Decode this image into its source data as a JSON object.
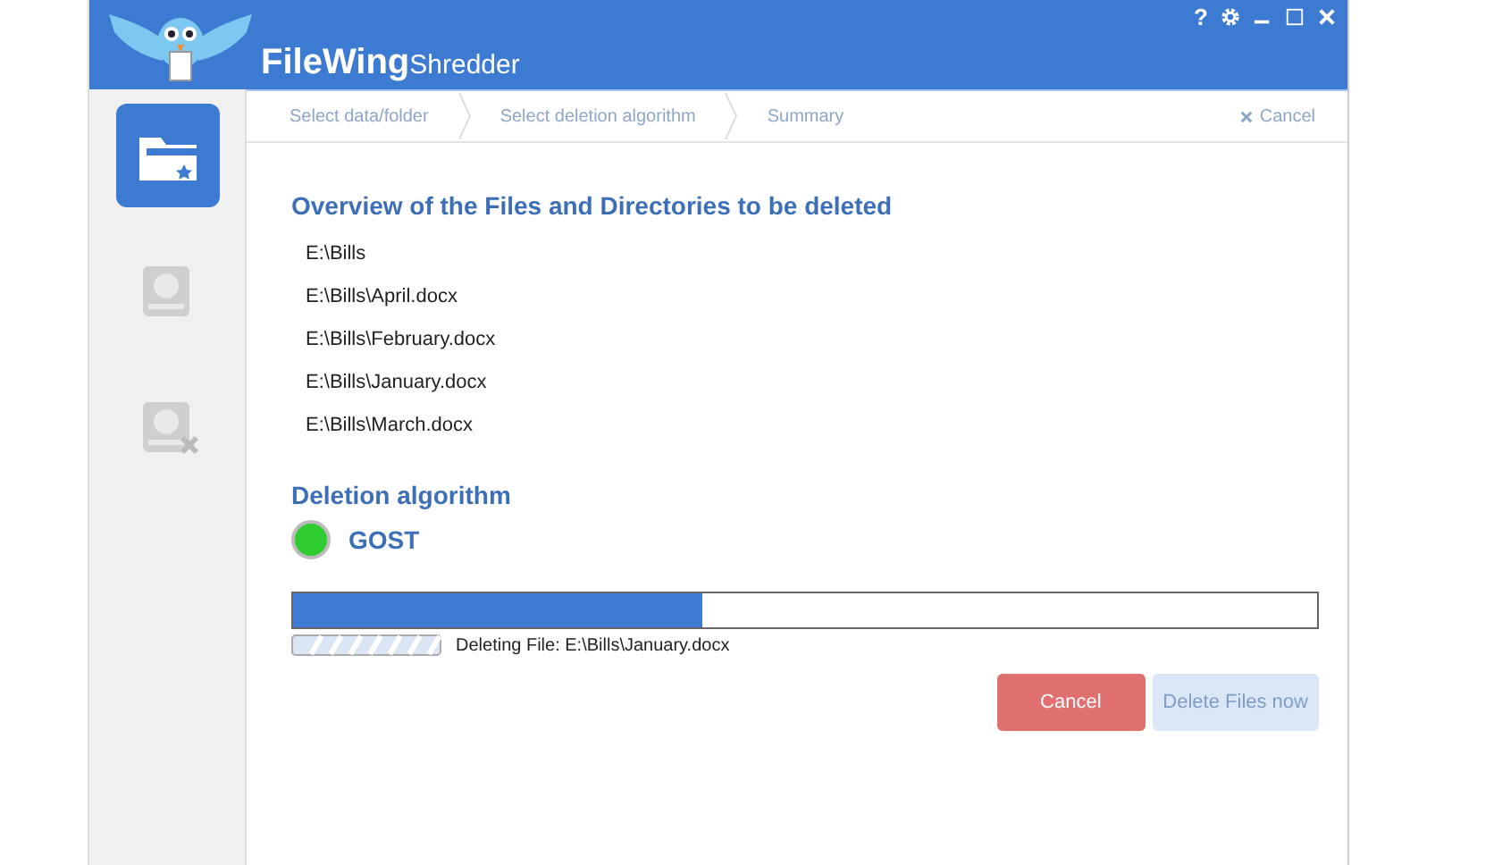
{
  "window": {
    "title_main": "FileWing",
    "title_sub": "Shredder",
    "help": "?"
  },
  "sidebar": {
    "items": [
      {
        "selected": true
      },
      {
        "selected": false
      },
      {
        "selected": false
      }
    ]
  },
  "steps": [
    "Select data/folder",
    "Select deletion algorithm",
    "Summary"
  ],
  "step_cancel": "Cancel",
  "overview": {
    "heading": "Overview of the Files and Directories to be deleted",
    "files": [
      "E:\\Bills",
      "E:\\Bills\\April.docx",
      "E:\\Bills\\February.docx",
      "E:\\Bills\\January.docx",
      "E:\\Bills\\March.docx"
    ]
  },
  "algorithm": {
    "heading": "Deletion algorithm",
    "name": "GOST",
    "color": "#2ecc2e"
  },
  "progress": {
    "level": 0.4,
    "status": "Deleting File: E:\\Bills\\January.docx"
  },
  "buttons": [
    {
      "label": "Cancel",
      "disabled": false
    },
    {
      "label": "Delete Files now",
      "disabled": true
    }
  ]
}
